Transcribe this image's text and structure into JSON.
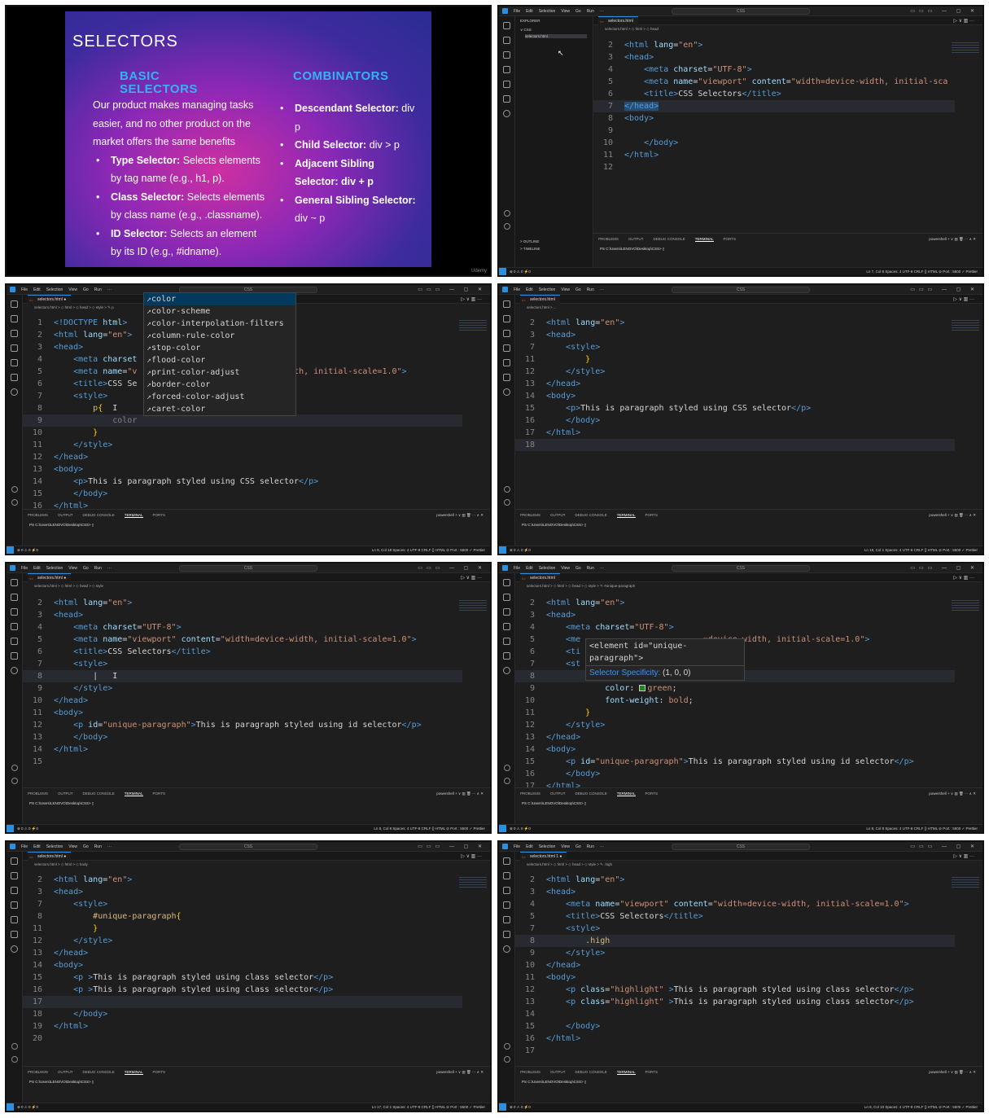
{
  "slide": {
    "title": "SELECTORS",
    "basic_heading_1": "BASIC",
    "basic_heading_2": "SELECTORS",
    "combinators_heading": "COMBINATORS",
    "intro_1": "Our product makes managing tasks",
    "intro_2": "easier, and no other product on the",
    "intro_3": "market offers the same benefits",
    "basic_items": [
      {
        "bold": "Type Selector:",
        "text": " Selects elements",
        "cont": "by tag name (e.g., h1, p)."
      },
      {
        "bold": "Class Selector:",
        "text": " Selects elements",
        "cont": "by class name (e.g., .classname)."
      },
      {
        "bold": "ID Selector:",
        "text": " Selects an element",
        "cont": "by its ID (e.g., #idname)."
      }
    ],
    "combinator_items": [
      {
        "bold": "Descendant Selector:",
        "text": " div",
        "cont": "p"
      },
      {
        "bold": "Child Selector:",
        "text": " div > p",
        "cont": ""
      },
      {
        "bold": "Adjacent Sibling",
        "text": "",
        "cont": "Selector: div + p"
      },
      {
        "bold": "General Sibling Selector:",
        "text": "",
        "cont": "div ~ p"
      }
    ],
    "watermark": "Udemy"
  },
  "ui": {
    "menu": [
      "File",
      "Edit",
      "Selection",
      "View",
      "Go",
      "Run",
      "···"
    ],
    "search": "CSS",
    "tab": "selectors.html",
    "tab_modified": "selectors.html ●",
    "tab_modified_problems": "selectors.html 1 ●",
    "panel_tabs": [
      "PROBLEMS",
      "OUTPUT",
      "DEBUG CONSOLE",
      "TERMINAL",
      "PORTS"
    ],
    "terminal_prompt": "PS C:\\Users\\LENOVO\\Desktop\\CSS> ▯",
    "terminal_shell": "powershell  + ∨  ▥  🗑  ···  ∧  ✕",
    "status_left": "⊗ 0 ⚠ 0   ⚡0",
    "status_right_1": "Ln 7, Col 8   Spaces: 4   UTF-8   CRLF   {} HTML   ⊘ Port : 5500   ✓ Prettier",
    "status_right_2": "Ln 9, Col 18   Spaces: 4   UTF-8   CRLF   {} HTML   ⊘ Port : 5500   ✓ Prettier",
    "status_right_3": "Ln 18, Col 1   Spaces: 4   UTF-8   CRLF   {} HTML   ⊘ Port : 5500   ✓ Prettier",
    "status_right_4": "Ln 8, Col 8   Spaces: 4   UTF-8   CRLF   {} HTML   ⊘ Port : 5500   ✓ Prettier",
    "status_right_5": "Ln 8, Col 8   Spaces: 4   UTF-8   CRLF   {} HTML   ⊘ Port : 5500   ✓ Prettier",
    "status_right_6": "Ln 17, Col 1   Spaces: 4   UTF-8   CRLF   {} HTML   ⊘ Port : 5500   ✓ Prettier",
    "status_right_7": "Ln 8, Col 10   Spaces: 4   UTF-8   CRLF   {} HTML   ⊘ Port : 5500   ✓ Prettier",
    "explorer_title": "EXPLORER",
    "explorer_folder": "∨ CSS",
    "explorer_file": "selectors.html",
    "explorer_outline": "> OUTLINE",
    "explorer_timeline": "> TIMELINE",
    "crumb_head": "selectors.html > ◇ html > ◇ head",
    "crumb_style_p": "selectors.html > ◇ html > ◇ head > ◇ style > ✎ p",
    "crumb_html": "selectors.html > ...",
    "crumb_style": "selectors.html > ◇ html > ◇ head > ◇ style",
    "crumb_unique": "selectors.html > ◇ html > ◇ head > ◇ style > ✎ #unique-paragraph",
    "crumb_body": "selectors.html > ◇ html > ◇ body",
    "crumb_high": "selectors.html > ◇ html > ◇ head > ◇ style > ✎ .high"
  },
  "p2": {
    "lines": [
      {
        "n": "2",
        "html": "<span class='tag'>&lt;html</span> <span class='att'>lang</span>=<span class='str'>\"en\"</span><span class='tag'>&gt;</span>"
      },
      {
        "n": "3",
        "html": "<span class='tag'>&lt;head&gt;</span>"
      },
      {
        "n": "4",
        "html": "    <span class='tag'>&lt;meta</span> <span class='att'>charset</span>=<span class='str'>\"UTF-8\"</span><span class='tag'>&gt;</span>"
      },
      {
        "n": "5",
        "html": "    <span class='tag'>&lt;meta</span> <span class='att'>name</span>=<span class='str'>\"viewport\"</span> <span class='att'>content</span>=<span class='str'>\"width=device-width, initial-sca</span>"
      },
      {
        "n": "6",
        "html": "    <span class='tag'>&lt;title&gt;</span>CSS Selectors<span class='tag'>&lt;/title&gt;</span>"
      },
      {
        "n": "7",
        "html": "<span class='tag hlword'>&lt;/head&gt;</span>"
      },
      {
        "n": "8",
        "html": "<span class='tag'>&lt;body&gt;</span>"
      },
      {
        "n": "9",
        "html": ""
      },
      {
        "n": "10",
        "html": "    <span class='tag'>&lt;/body&gt;</span>"
      },
      {
        "n": "11",
        "html": "<span class='tag'>&lt;/html&gt;</span>"
      },
      {
        "n": "12",
        "html": ""
      }
    ]
  },
  "p3": {
    "lines": [
      {
        "n": "1",
        "html": "<span class='tag'>&lt;!DOCTYPE</span> <span class='att'>html</span><span class='tag'>&gt;</span>"
      },
      {
        "n": "2",
        "html": "<span class='tag'>&lt;html</span> <span class='att'>lang</span>=<span class='str'>\"en\"</span><span class='tag'>&gt;</span>"
      },
      {
        "n": "3",
        "html": "<span class='tag'>&lt;head&gt;</span>"
      },
      {
        "n": "4",
        "html": "    <span class='tag'>&lt;meta</span> <span class='att'>charset</span>"
      },
      {
        "n": "5",
        "html": "    <span class='tag'>&lt;meta</span> <span class='att'>name</span>=<span class='str'>\"v</span>                             <span class='str'>width, initial-scale=1.0\"</span><span class='tag'>&gt;</span>"
      },
      {
        "n": "6",
        "html": "    <span class='tag'>&lt;title&gt;</span>CSS Se"
      },
      {
        "n": "7",
        "html": "    <span class='tag'>&lt;style&gt;</span>"
      },
      {
        "n": "8",
        "html": "        <span class='sel'>p</span><span class='br'>{</span>  I"
      },
      {
        "n": "9",
        "html": "            <span class='gry'>color</span>"
      },
      {
        "n": "10",
        "html": "        <span class='br'>}</span>"
      },
      {
        "n": "11",
        "html": "    <span class='tag'>&lt;/style&gt;</span>"
      },
      {
        "n": "12",
        "html": "<span class='tag'>&lt;/head&gt;</span>"
      },
      {
        "n": "13",
        "html": "<span class='tag'>&lt;body&gt;</span>"
      },
      {
        "n": "14",
        "html": "    <span class='tag'>&lt;p&gt;</span>This is paragraph styled using CSS selector<span class='tag'>&lt;/p&gt;</span>"
      },
      {
        "n": "15",
        "html": "    <span class='tag'>&lt;/body&gt;</span>"
      },
      {
        "n": "16",
        "html": "<span class='tag'>&lt;/html&gt;</span>"
      }
    ],
    "suggestions": [
      "color",
      "color-scheme",
      "color-interpolation-filters",
      "column-rule-color",
      "stop-color",
      "flood-color",
      "print-color-adjust",
      "border-color",
      "forced-color-adjust",
      "caret-color"
    ]
  },
  "p4": {
    "lines": [
      {
        "n": "2",
        "html": "<span class='tag'>&lt;html</span> <span class='att'>lang</span>=<span class='str'>\"en\"</span><span class='tag'>&gt;</span>"
      },
      {
        "n": "3",
        "html": "<span class='tag'>&lt;head&gt;</span>"
      },
      {
        "n": "7",
        "html": "    <span class='tag'>&lt;style&gt;</span>"
      },
      {
        "n": "11",
        "html": "        <span class='br'>}</span>"
      },
      {
        "n": "12",
        "html": "    <span class='tag'>&lt;/style&gt;</span>"
      },
      {
        "n": "13",
        "html": "<span class='tag'>&lt;/head&gt;</span>"
      },
      {
        "n": "14",
        "html": "<span class='tag'>&lt;body&gt;</span>"
      },
      {
        "n": "15",
        "html": "    <span class='tag'>&lt;p&gt;</span>This is paragraph styled using CSS selector<span class='tag'>&lt;/p&gt;</span>"
      },
      {
        "n": "16",
        "html": "    <span class='tag'>&lt;/body&gt;</span>"
      },
      {
        "n": "17",
        "html": "<span class='tag'>&lt;/html&gt;</span>"
      },
      {
        "n": "18",
        "html": ""
      }
    ]
  },
  "p5": {
    "lines": [
      {
        "n": "2",
        "html": "<span class='tag'>&lt;html</span> <span class='att'>lang</span>=<span class='str'>\"en\"</span><span class='tag'>&gt;</span>"
      },
      {
        "n": "3",
        "html": "<span class='tag'>&lt;head&gt;</span>"
      },
      {
        "n": "4",
        "html": "    <span class='tag'>&lt;meta</span> <span class='att'>charset</span>=<span class='str'>\"UTF-8\"</span><span class='tag'>&gt;</span>"
      },
      {
        "n": "5",
        "html": "    <span class='tag'>&lt;meta</span> <span class='att'>name</span>=<span class='str'>\"viewport\"</span> <span class='att'>content</span>=<span class='str'>\"width=device-width, initial-scale=1.0\"</span><span class='tag'>&gt;</span>"
      },
      {
        "n": "6",
        "html": "    <span class='tag'>&lt;title&gt;</span>CSS Selectors<span class='tag'>&lt;/title&gt;</span>"
      },
      {
        "n": "7",
        "html": "    <span class='tag'>&lt;style&gt;</span>"
      },
      {
        "n": "8",
        "html": "        |   I"
      },
      {
        "n": "9",
        "html": "    <span class='tag'>&lt;/style&gt;</span>"
      },
      {
        "n": "10",
        "html": "<span class='tag'>&lt;/head&gt;</span>"
      },
      {
        "n": "11",
        "html": "<span class='tag'>&lt;body&gt;</span>"
      },
      {
        "n": "12",
        "html": "    <span class='tag'>&lt;p</span> <span class='att'>id</span>=<span class='str'>\"unique-paragraph\"</span><span class='tag'>&gt;</span>This is paragraph styled using id selector<span class='tag'>&lt;/p&gt;</span>"
      },
      {
        "n": "13",
        "html": "    <span class='tag'>&lt;/body&gt;</span>"
      },
      {
        "n": "14",
        "html": "<span class='tag'>&lt;/html&gt;</span>"
      },
      {
        "n": "15",
        "html": ""
      }
    ]
  },
  "p6": {
    "lines": [
      {
        "n": "2",
        "html": "<span class='tag'>&lt;html</span> <span class='att'>lang</span>=<span class='str'>\"en\"</span><span class='tag'>&gt;</span>"
      },
      {
        "n": "3",
        "html": "<span class='tag'>&lt;head&gt;</span>"
      },
      {
        "n": "4",
        "html": "    <span class='tag'>&lt;meta</span> <span class='att'>charset</span>=<span class='str'>\"UTF-8\"</span><span class='tag'>&gt;</span>"
      },
      {
        "n": "5",
        "html": "    <span class='tag'>&lt;me</span>                         <span class='str'>=device-width, initial-scale=1.0\"</span><span class='tag'>&gt;</span>"
      },
      {
        "n": "6",
        "html": "    <span class='tag'>&lt;ti</span>"
      },
      {
        "n": "7",
        "html": "    <span class='tag'>&lt;st</span>"
      },
      {
        "n": "8",
        "html": "        <span class='sel hlword'>#unique-paragraph</span><span class='br'>{</span>"
      },
      {
        "n": "9",
        "html": "            <span class='pr'>color</span>: <span class='swatch'></span><span class='vl'>green</span>;"
      },
      {
        "n": "10",
        "html": "            <span class='pr'>font-weight</span>: <span class='vl'>bold</span>;"
      },
      {
        "n": "11",
        "html": "        <span class='br'>}</span>"
      },
      {
        "n": "12",
        "html": "    <span class='tag'>&lt;/style&gt;</span>"
      },
      {
        "n": "13",
        "html": "<span class='tag'>&lt;/head&gt;</span>"
      },
      {
        "n": "14",
        "html": "<span class='tag'>&lt;body&gt;</span>"
      },
      {
        "n": "15",
        "html": "    <span class='tag'>&lt;p</span> <span class='att'>id</span>=<span class='str'>\"unique-paragraph\"</span><span class='tag'>&gt;</span>This is paragraph styled using id selector<span class='tag'>&lt;/p&gt;</span>"
      },
      {
        "n": "16",
        "html": "    <span class='tag'>&lt;/body&gt;</span>"
      },
      {
        "n": "17",
        "html": "<span class='tag'>&lt;/html&gt;</span>"
      }
    ],
    "hover_line1": "<element id=\"unique-paragraph\">",
    "hover_line2": "Selector Specificity: (1, 0, 0)"
  },
  "p7": {
    "lines": [
      {
        "n": "2",
        "html": "<span class='tag'>&lt;html</span> <span class='att'>lang</span>=<span class='str'>\"en\"</span><span class='tag'>&gt;</span>"
      },
      {
        "n": "3",
        "html": "<span class='tag'>&lt;head&gt;</span>"
      },
      {
        "n": "7",
        "html": "    <span class='tag'>&lt;style&gt;</span>"
      },
      {
        "n": "8",
        "html": "        <span class='sel'>#unique-paragraph</span><span class='br'>{</span>"
      },
      {
        "n": "11",
        "html": "        <span class='br'>}</span>"
      },
      {
        "n": "12",
        "html": "    <span class='tag'>&lt;/style&gt;</span>"
      },
      {
        "n": "13",
        "html": "<span class='tag'>&lt;/head&gt;</span>"
      },
      {
        "n": "14",
        "html": "<span class='tag'>&lt;body&gt;</span>"
      },
      {
        "n": "15",
        "html": "    <span class='tag'>&lt;p</span> <span class='tag'>&gt;</span>This is paragraph styled using class selector<span class='tag'>&lt;/p&gt;</span>"
      },
      {
        "n": "16",
        "html": "    <span class='tag'>&lt;p</span> <span class='tag'>&gt;</span>This is paragraph styled using class selector<span class='tag'>&lt;/p&gt;</span>"
      },
      {
        "n": "17",
        "html": ""
      },
      {
        "n": "18",
        "html": "    <span class='tag'>&lt;/body&gt;</span>"
      },
      {
        "n": "19",
        "html": "<span class='tag'>&lt;/html&gt;</span>"
      },
      {
        "n": "20",
        "html": ""
      }
    ]
  },
  "p8": {
    "lines": [
      {
        "n": "2",
        "html": "<span class='tag'>&lt;html</span> <span class='att'>lang</span>=<span class='str'>\"en\"</span><span class='tag'>&gt;</span>"
      },
      {
        "n": "3",
        "html": "<span class='tag'>&lt;head&gt;</span>"
      },
      {
        "n": "4",
        "html": "    <span class='tag'>&lt;meta</span> <span class='att'>name</span>=<span class='str'>\"viewport\"</span> <span class='att'>content</span>=<span class='str'>\"width=device-width, initial-scale=1.0\"</span><span class='tag'>&gt;</span>"
      },
      {
        "n": "5",
        "html": "    <span class='tag'>&lt;title&gt;</span>CSS Selectors<span class='tag'>&lt;/title&gt;</span>"
      },
      {
        "n": "7",
        "html": "    <span class='tag'>&lt;style&gt;</span>"
      },
      {
        "n": "8",
        "html": "        <span class='sel'>.high</span>"
      },
      {
        "n": "9",
        "html": "    <span class='tag'>&lt;/style&gt;</span>"
      },
      {
        "n": "10",
        "html": "<span class='tag'>&lt;/head&gt;</span>"
      },
      {
        "n": "11",
        "html": "<span class='tag'>&lt;body&gt;</span>"
      },
      {
        "n": "12",
        "html": "    <span class='tag'>&lt;p</span> <span class='att'>class</span>=<span class='str'>\"highlight\"</span> <span class='tag'>&gt;</span>This is paragraph styled using class selector<span class='tag'>&lt;/p&gt;</span>"
      },
      {
        "n": "13",
        "html": "    <span class='tag'>&lt;p</span> <span class='att'>class</span>=<span class='str'>\"highlight\"</span> <span class='tag'>&gt;</span>This is paragraph styled using class selector<span class='tag'>&lt;/p&gt;</span>"
      },
      {
        "n": "14",
        "html": ""
      },
      {
        "n": "15",
        "html": "    <span class='tag'>&lt;/body&gt;</span>"
      },
      {
        "n": "16",
        "html": "<span class='tag'>&lt;/html&gt;</span>"
      },
      {
        "n": "17",
        "html": ""
      }
    ]
  }
}
